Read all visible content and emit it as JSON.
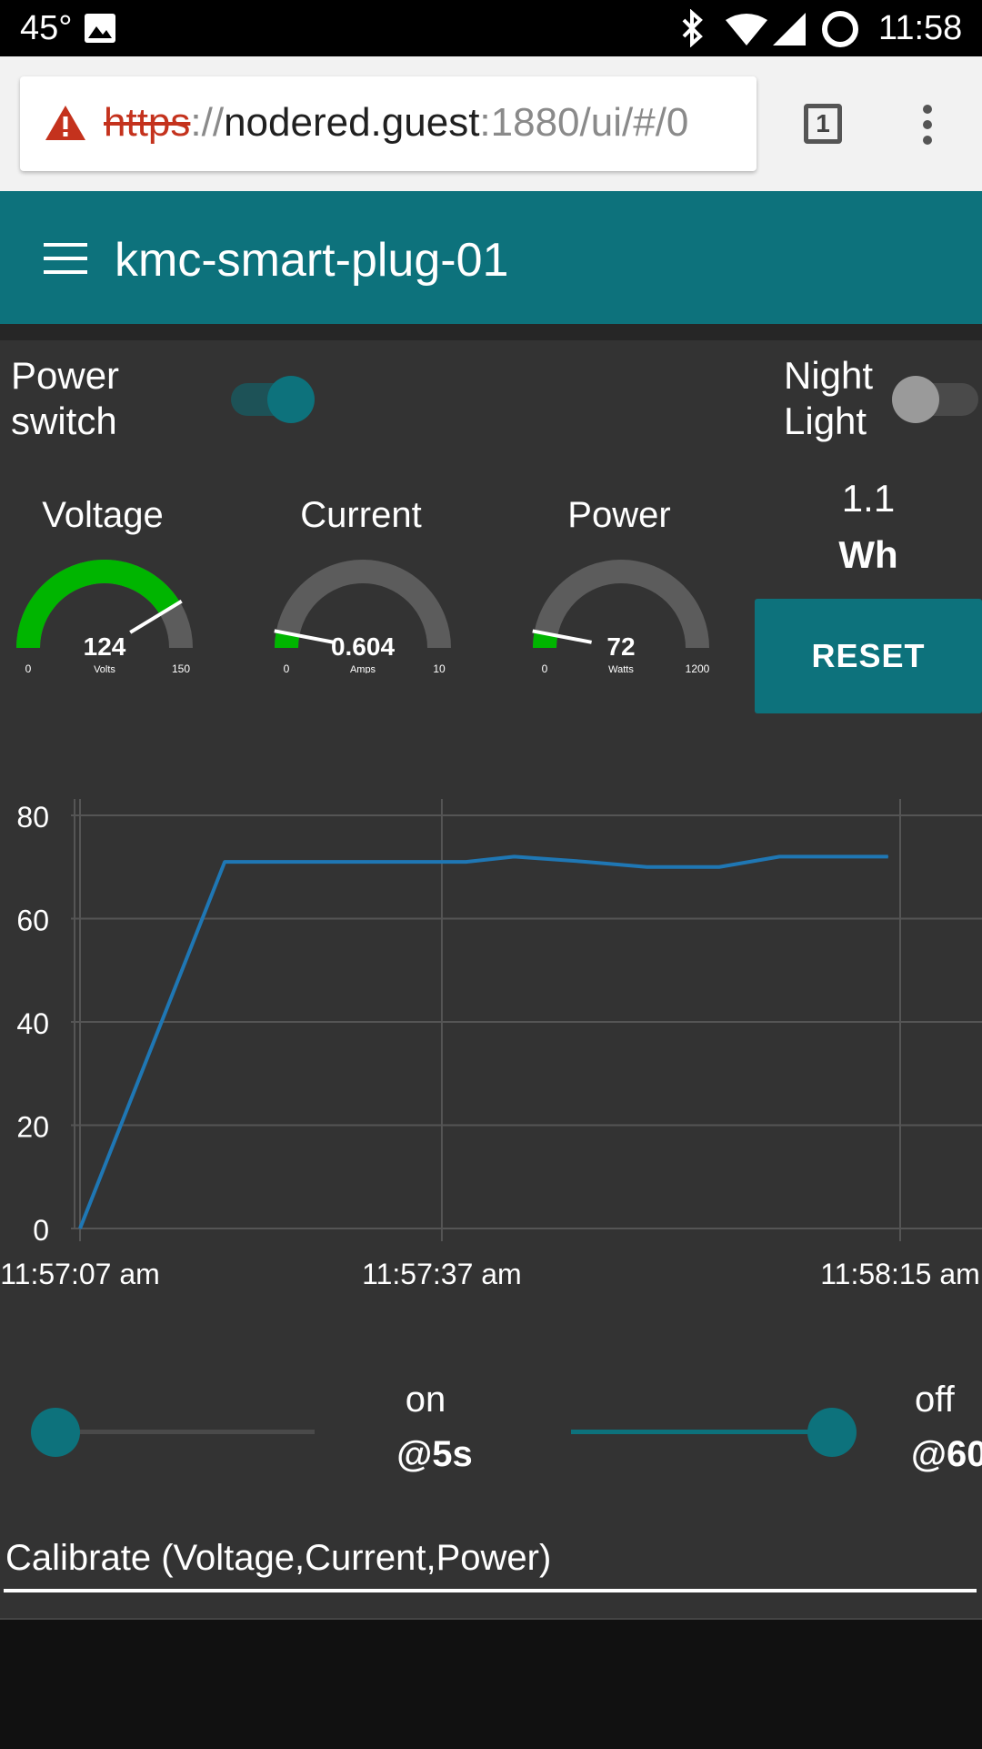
{
  "status_bar": {
    "temperature": "45°",
    "time": "11:58",
    "icons": [
      "image-icon",
      "bluetooth-icon",
      "wifi-icon",
      "signal-icon",
      "battery-icon"
    ]
  },
  "browser": {
    "url_scheme": "https",
    "url_sep": "://",
    "url_host": "nodered.guest",
    "url_rest": ":1880/ui/#/0",
    "tab_count": "1"
  },
  "app": {
    "title": "kmc-smart-plug-01",
    "accent": "#0d727c"
  },
  "switches": {
    "power": {
      "label_line1": "Power",
      "label_line2": "switch",
      "state": "on"
    },
    "night": {
      "label_line1": "Night",
      "label_line2": "Light",
      "state": "off"
    }
  },
  "gauges": [
    {
      "title": "Voltage",
      "value": "124",
      "unit": "Volts",
      "min": "0",
      "max": "150",
      "fraction": 0.8267
    },
    {
      "title": "Current",
      "value": "0.604",
      "unit": "Amps",
      "min": "0",
      "max": "10",
      "fraction": 0.0604
    },
    {
      "title": "Power",
      "value": "72",
      "unit": "Watts",
      "min": "0",
      "max": "1200",
      "fraction": 0.06
    }
  ],
  "energy": {
    "value": "1.1",
    "unit": "Wh",
    "reset_label": "RESET"
  },
  "chart_data": {
    "type": "line",
    "title": "",
    "xlabel": "",
    "ylabel": "",
    "ylim": [
      0,
      80
    ],
    "yticks": [
      "0",
      "20",
      "40",
      "60",
      "80"
    ],
    "xticks": [
      "11:57:07 am",
      "11:57:37 am",
      "11:58:15 am"
    ],
    "grid": true,
    "line_color": "#1f77b4",
    "x": [
      "11:57:07",
      "11:57:19",
      "11:57:31",
      "11:57:37",
      "11:57:39",
      "11:57:43",
      "11:57:49",
      "11:57:54",
      "11:58:00",
      "11:58:05",
      "11:58:14"
    ],
    "values": [
      0,
      71,
      71,
      71,
      71,
      72,
      71,
      70,
      70,
      72,
      72
    ]
  },
  "timers": {
    "on": {
      "label": "on",
      "value": "@5s"
    },
    "off": {
      "label": "off",
      "value": "@60"
    }
  },
  "calibrate": {
    "label": "Calibrate (Voltage,Current,Power)"
  }
}
